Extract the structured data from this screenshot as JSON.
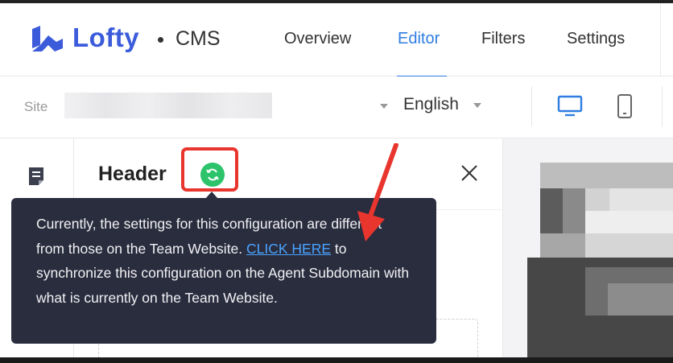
{
  "app": {
    "brand": "Lofty",
    "separator": "•",
    "product": "CMS",
    "brand_color": "#3b5bdb"
  },
  "nav": {
    "tabs": [
      {
        "label": "Overview",
        "active": false
      },
      {
        "label": "Editor",
        "active": true
      },
      {
        "label": "Filters",
        "active": false
      },
      {
        "label": "Settings",
        "active": false
      }
    ],
    "active_color": "#2f7de1"
  },
  "toolbar": {
    "site_label": "Site",
    "site_value_icon": "redacted",
    "language": "English",
    "devices": [
      {
        "icon": "desktop-icon",
        "active": true
      },
      {
        "icon": "mobile-icon",
        "active": false
      }
    ]
  },
  "rail": {
    "icons": [
      "page-icon"
    ]
  },
  "panel": {
    "title": "Header",
    "sync_icon": "sync-icon",
    "sync_color": "#2cc36b",
    "highlight_color": "#e8352e",
    "close_icon": "close-icon"
  },
  "tooltip": {
    "text_before": "Currently, the settings for this configuration are different from those on the Team Website. ",
    "link": "CLICK HERE",
    "text_after": " to synchronize this configuration on the Agent Subdomain with what is currently on the Team Website.",
    "link_color": "#4aa3ff",
    "background": "#2a2d3e"
  },
  "annotation": {
    "arrow_color": "#e8352e"
  }
}
